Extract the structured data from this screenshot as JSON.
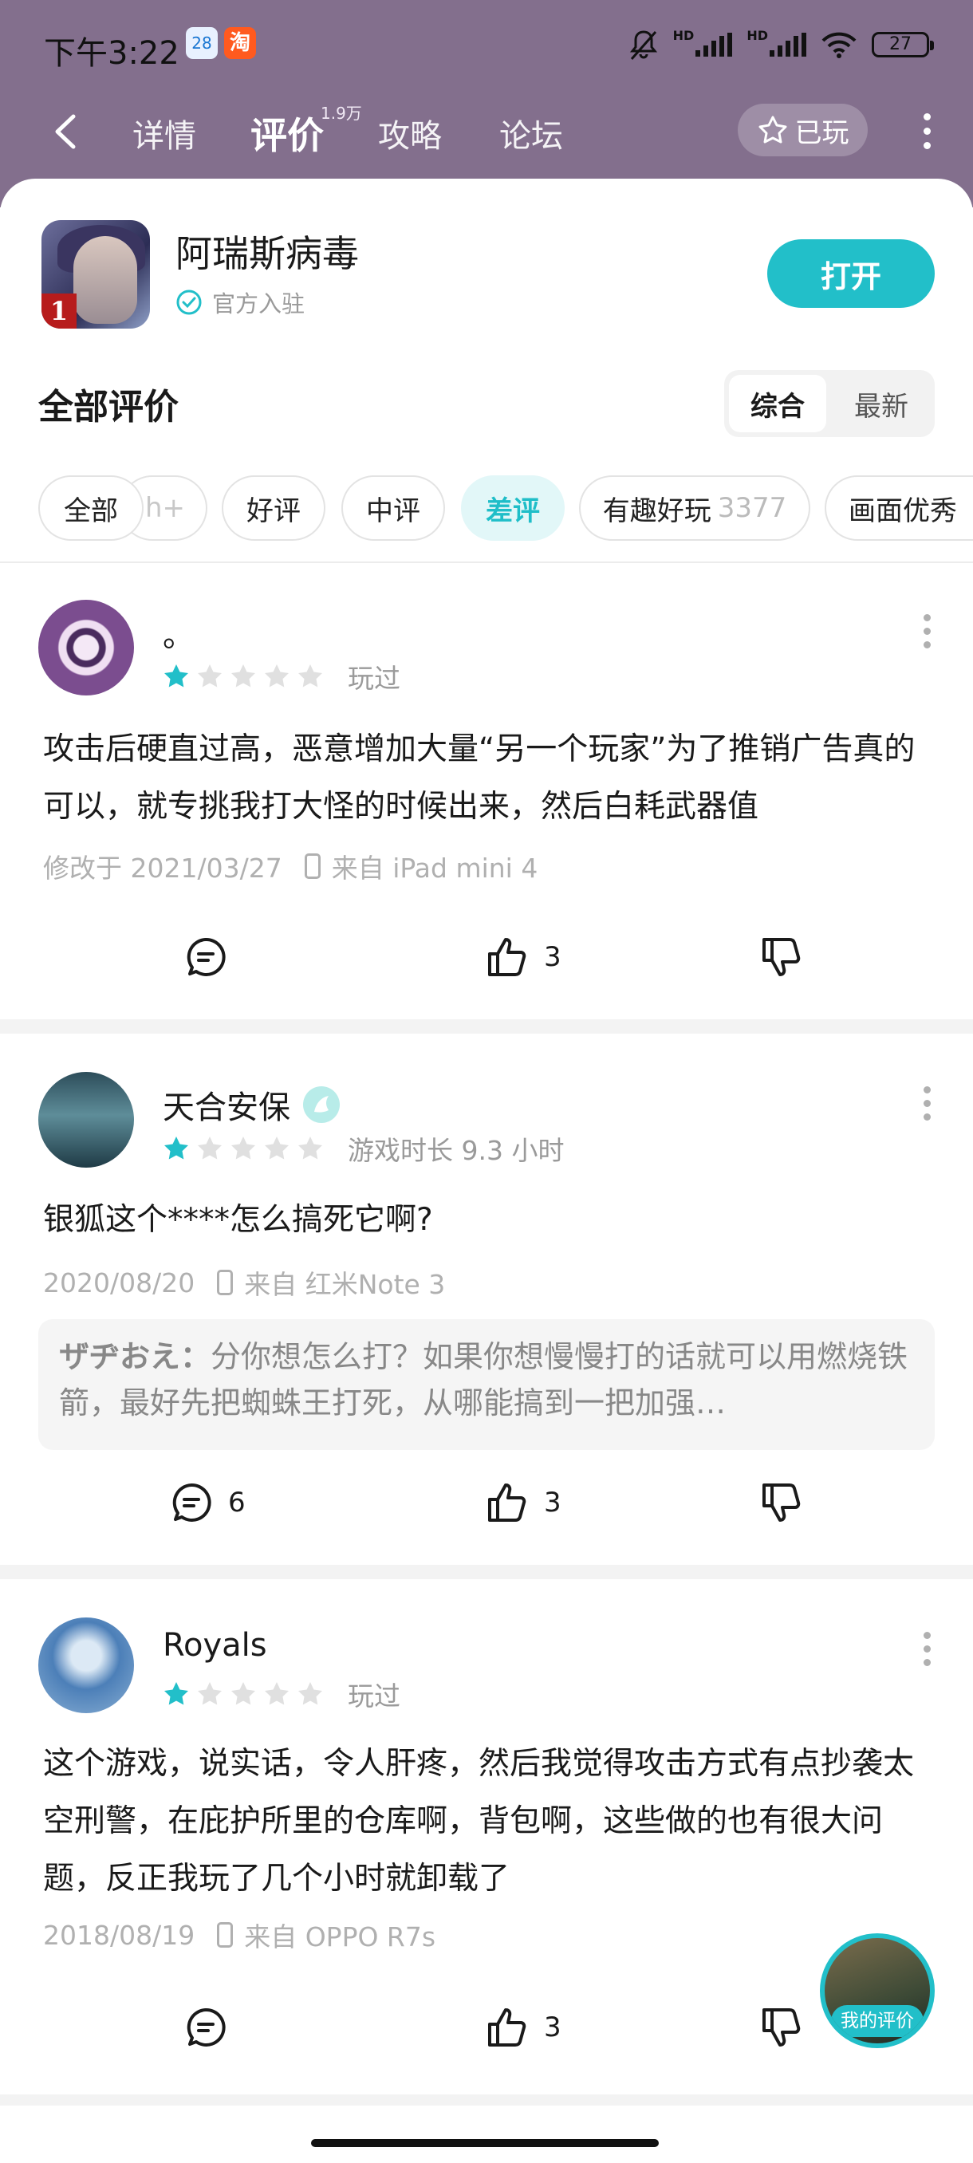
{
  "status_bar": {
    "time": "下午3:22",
    "app_badge_1": "28",
    "app_badge_2": "淘",
    "hd_1": "HD",
    "hd_2": "HD",
    "battery": "27"
  },
  "nav": {
    "tabs": [
      {
        "label": "详情"
      },
      {
        "label": "评价",
        "count": "1.9万"
      },
      {
        "label": "攻略"
      },
      {
        "label": "论坛"
      }
    ],
    "played_label": "已玩"
  },
  "game": {
    "name": "阿瑞斯病毒",
    "official_label": "官方入驻",
    "icon_badge": "1",
    "open_label": "打开"
  },
  "reviews_section": {
    "title": "全部评价",
    "sort": [
      "综合",
      "最新"
    ]
  },
  "filters": [
    {
      "label": "全部"
    },
    {
      "label": "h+"
    },
    {
      "label": "好评"
    },
    {
      "label": "中评"
    },
    {
      "label": "差评"
    },
    {
      "label": "有趣好玩",
      "count": "3377"
    },
    {
      "label": "画面优秀"
    }
  ],
  "reviews": [
    {
      "user": "。",
      "stars": 1,
      "tag": "玩过",
      "text": "攻击后硬直过高，恶意增加大量“另一个玩家”为了推销广告真的可以，就专挑我打大怪的时候出来，然后白耗武器值",
      "date": "修改于 2021/03/27",
      "device": "来自 iPad mini 4",
      "likes": "3"
    },
    {
      "user": "天合安保",
      "stars": 1,
      "tag": "游戏时长 9.3 小时",
      "text": "银狐这个****怎么搞死它啊?",
      "date": "2020/08/20",
      "device": "来自 红米Note 3",
      "reply_user": "ザヂおえ：",
      "reply_text": "分你想怎么打？如果你想慢慢打的话就可以用燃烧铁箭，最好先把蜘蛛王打死，从哪能搞到一把加强…",
      "comments": "6",
      "likes": "3"
    },
    {
      "user": "Royals",
      "stars": 1,
      "tag": "玩过",
      "text": "这个游戏，说实话，令人肝疼，然后我觉得攻击方式有点抄袭太空刑警，在庇护所里的仓库啊，背包啊，这些做的也有很大问题，反正我玩了几个小时就卸载了",
      "date": "2018/08/19",
      "device": "来自 OPPO R7s",
      "likes": "3"
    }
  ],
  "my_review_label": "我的评价",
  "colors": {
    "accent": "#22bfc9",
    "header": "#836f8d",
    "star_on": "#22bfc9",
    "star_off": "#e0e0e0"
  }
}
